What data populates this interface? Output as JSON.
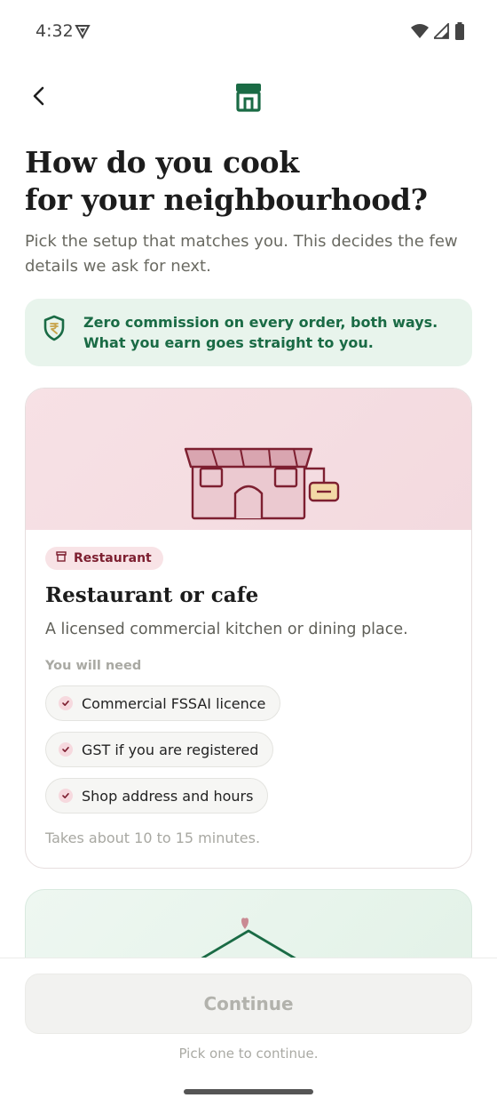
{
  "status": {
    "time": "4:32",
    "icons": [
      "vpn-icon",
      "wifi-icon",
      "signal-icon",
      "battery-icon"
    ]
  },
  "nav": {
    "back_icon": "chevron-left-icon",
    "logo_icon": "storefront-icon"
  },
  "title": {
    "line1": "How do you cook",
    "line2": "for your neighbourhood?"
  },
  "subtitle": "Pick the setup that matches you. This decides the few details we ask for next.",
  "commission_banner": {
    "icon": "rupee-shield-icon",
    "text": "Zero commission on every order, both ways. What you earn goes straight to you."
  },
  "options": [
    {
      "badge": "Restaurant",
      "badge_icon": "store-icon",
      "title": "Restaurant or cafe",
      "description": "A licensed commercial kitchen or dining place.",
      "need_label": "You will need",
      "requirements": [
        "Commercial FSSAI licence",
        "GST if you are registered",
        "Shop address and hours"
      ],
      "duration": "Takes about 10 to 15 minutes.",
      "illustration": "restaurant-building-illustration"
    },
    {
      "illustration": "home-heart-illustration"
    }
  ],
  "footer": {
    "continue_label": "Continue",
    "hint": "Pick one to continue."
  },
  "colors": {
    "brand_green": "#1a6b45",
    "restaurant_accent": "#7d1f30",
    "banner_bg": "#e8f4ec",
    "restaurant_bg": "#f7e1e5"
  }
}
